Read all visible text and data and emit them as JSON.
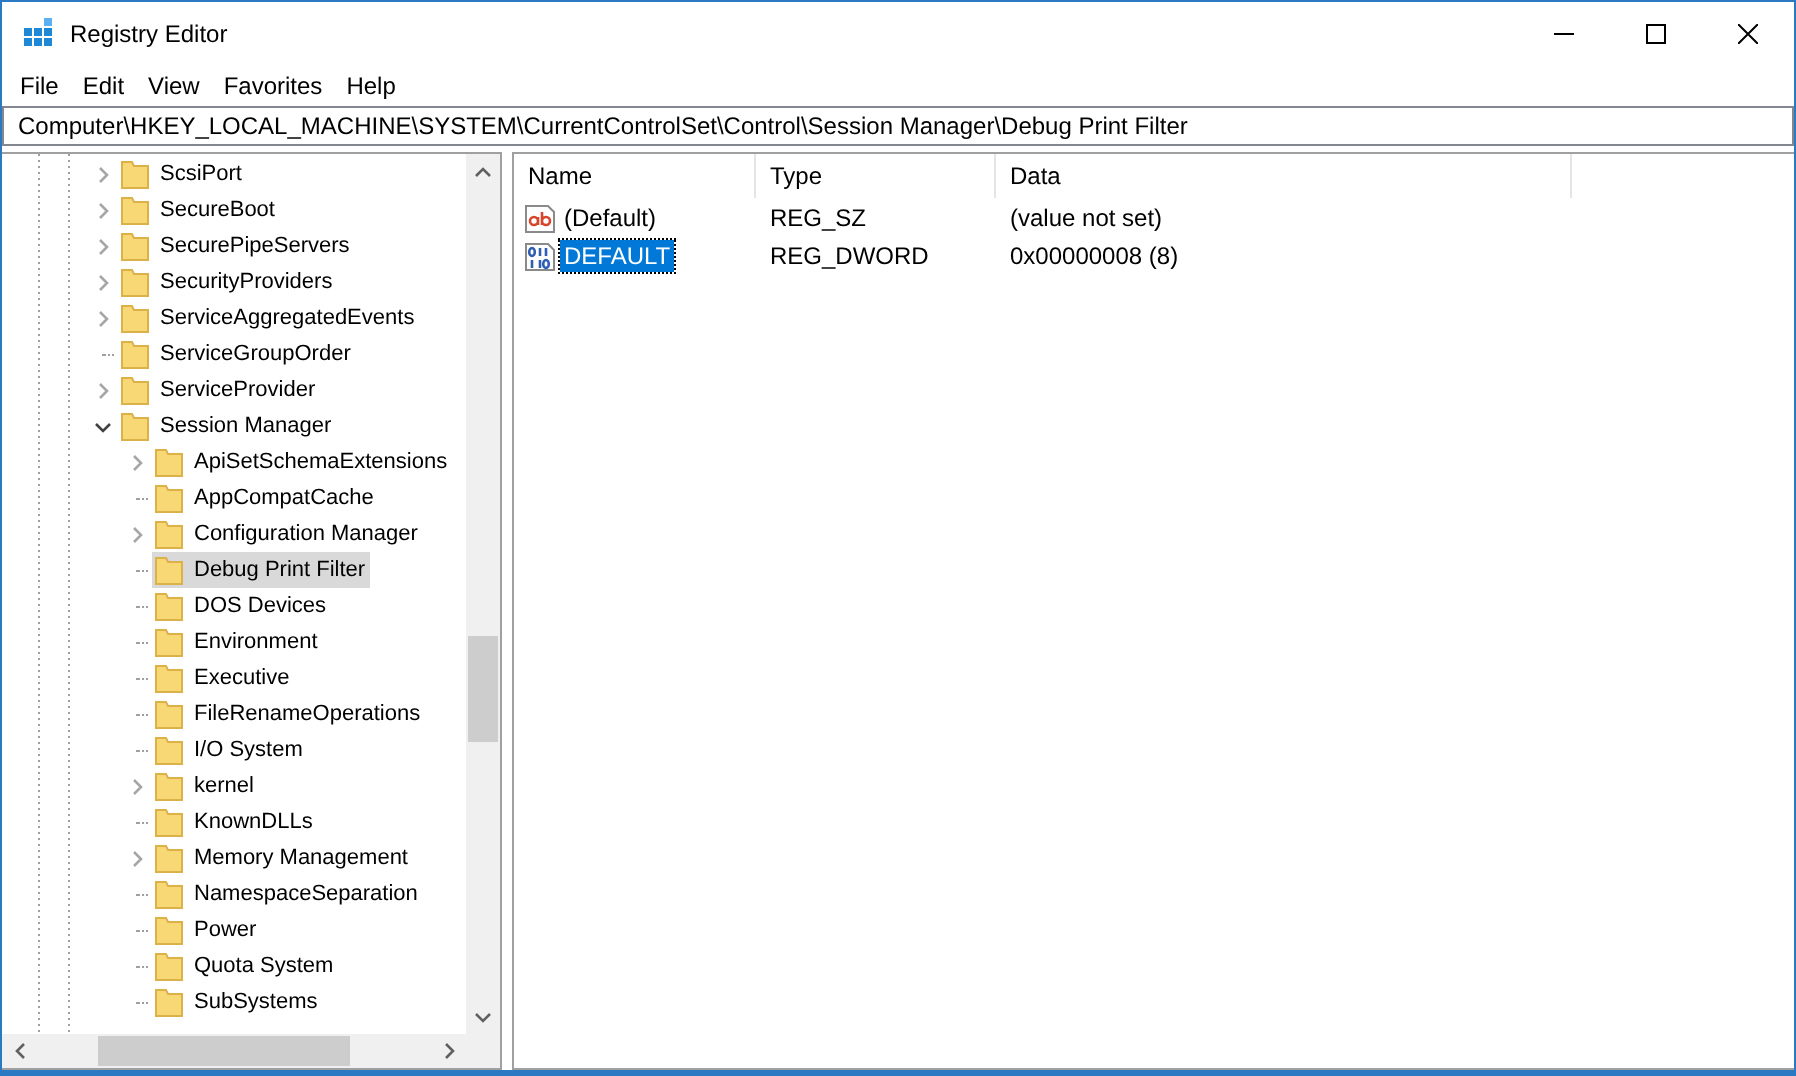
{
  "window": {
    "title": "Registry Editor"
  },
  "menu": [
    "File",
    "Edit",
    "View",
    "Favorites",
    "Help"
  ],
  "address": "Computer\\HKEY_LOCAL_MACHINE\\SYSTEM\\CurrentControlSet\\Control\\Session Manager\\Debug Print Filter",
  "tree": [
    {
      "label": "ScsiPort",
      "expandable": true,
      "expanded": false,
      "selected": false
    },
    {
      "label": "SecureBoot",
      "expandable": true,
      "expanded": false,
      "selected": false
    },
    {
      "label": "SecurePipeServers",
      "expandable": true,
      "expanded": false,
      "selected": false
    },
    {
      "label": "SecurityProviders",
      "expandable": true,
      "expanded": false,
      "selected": false
    },
    {
      "label": "ServiceAggregatedEvents",
      "expandable": true,
      "expanded": false,
      "selected": false
    },
    {
      "label": "ServiceGroupOrder",
      "expandable": false,
      "selected": false
    },
    {
      "label": "ServiceProvider",
      "expandable": true,
      "expanded": false,
      "selected": false
    },
    {
      "label": "Session Manager",
      "expandable": true,
      "expanded": true,
      "selected": false,
      "children": [
        {
          "label": "ApiSetSchemaExtensions",
          "expandable": true,
          "expanded": false,
          "selected": false
        },
        {
          "label": "AppCompatCache",
          "expandable": false,
          "selected": false
        },
        {
          "label": "Configuration Manager",
          "expandable": true,
          "expanded": false,
          "selected": false
        },
        {
          "label": "Debug Print Filter",
          "expandable": false,
          "selected": true
        },
        {
          "label": "DOS Devices",
          "expandable": false,
          "selected": false
        },
        {
          "label": "Environment",
          "expandable": false,
          "selected": false
        },
        {
          "label": "Executive",
          "expandable": false,
          "selected": false
        },
        {
          "label": "FileRenameOperations",
          "expandable": false,
          "selected": false
        },
        {
          "label": "I/O System",
          "expandable": false,
          "selected": false
        },
        {
          "label": "kernel",
          "expandable": true,
          "expanded": false,
          "selected": false
        },
        {
          "label": "KnownDLLs",
          "expandable": false,
          "selected": false
        },
        {
          "label": "Memory Management",
          "expandable": true,
          "expanded": false,
          "selected": false
        },
        {
          "label": "NamespaceSeparation",
          "expandable": false,
          "selected": false
        },
        {
          "label": "Power",
          "expandable": false,
          "selected": false
        },
        {
          "label": "Quota System",
          "expandable": false,
          "selected": false
        },
        {
          "label": "SubSystems",
          "expandable": false,
          "selected": false
        }
      ]
    }
  ],
  "values": {
    "columns": [
      "Name",
      "Type",
      "Data"
    ],
    "rows": [
      {
        "kind": "string",
        "name": "(Default)",
        "type": "REG_SZ",
        "data": "(value not set)",
        "selected": false
      },
      {
        "kind": "binary",
        "name": "DEFAULT",
        "type": "REG_DWORD",
        "data": "0x00000008 (8)",
        "selected": true
      }
    ]
  }
}
